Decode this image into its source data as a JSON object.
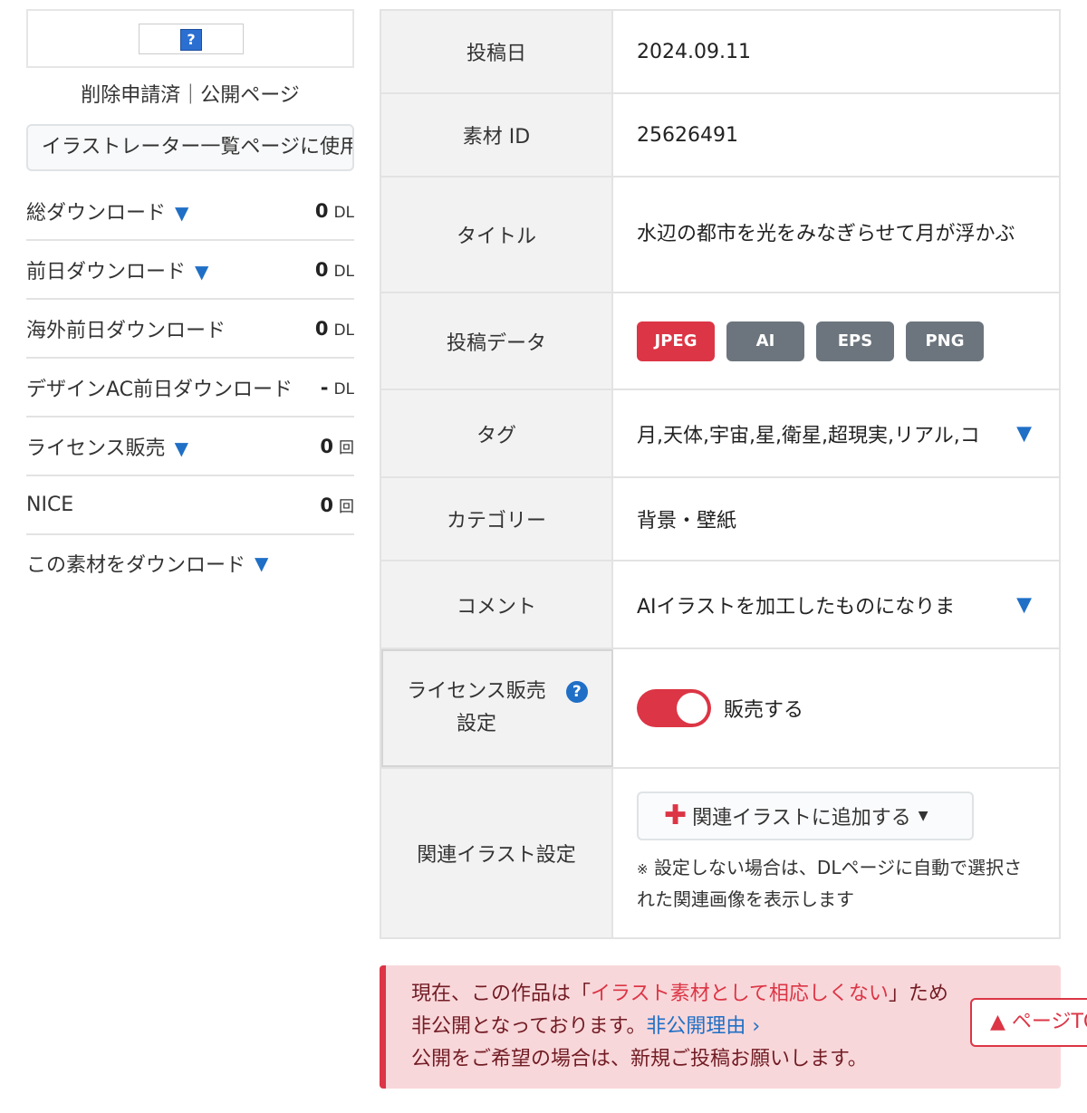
{
  "sidebar": {
    "thumbnail_icon": "question-icon",
    "thumbnail_glyph": "?",
    "status": "削除申請済｜公開ページ",
    "illustrator_button": "イラストレーター一覧ページに使用",
    "stats": [
      {
        "label": "総ダウンロード",
        "expand": "▼",
        "value": "0",
        "unit": "DL"
      },
      {
        "label": "前日ダウンロード",
        "expand": "▼",
        "value": "0",
        "unit": "DL"
      },
      {
        "label": "海外前日ダウンロード",
        "expand": "",
        "value": "0",
        "unit": "DL"
      },
      {
        "label": "デザインAC前日ダウンロード",
        "expand": "",
        "value": "-",
        "unit": "DL"
      },
      {
        "label": "ライセンス販売",
        "expand": "▼",
        "value": "0",
        "unit": "回"
      },
      {
        "label": "NICE",
        "expand": "",
        "value": "0",
        "unit": "回"
      }
    ],
    "download_link": "この素材をダウンロード",
    "download_expand": "▼"
  },
  "details": {
    "post_date_label": "投稿日",
    "post_date": "2024.09.11",
    "material_id_label": "素材 ID",
    "material_id": "25626491",
    "title_label": "タイトル",
    "title": "水辺の都市を光をみなぎらせて月が浮かぶ",
    "data_label": "投稿データ",
    "formats": [
      "JPEG",
      "AI",
      "EPS",
      "PNG"
    ],
    "tags_label": "タグ",
    "tags": "月,天体,宇宙,星,衛星,超現実,リアル,コ",
    "category_label": "カテゴリー",
    "category": "背景・壁紙",
    "comment_label": "コメント",
    "comment": "AIイラストを加工したものになりま",
    "license_label_1": "ライセンス販売",
    "license_label_2": "設定",
    "license_toggle_label": "販売する",
    "related_label": "関連イラスト設定",
    "related_button": "関連イラストに追加する",
    "related_note_mark": "※",
    "related_note": "設定しない場合は、DLページに自動で選択された関連画像を表示します"
  },
  "alert": {
    "line1_prefix": "現在、この作品は「",
    "line1_highlight": "イラスト素材として相応しくない",
    "line1_suffix": "」ため",
    "line2_prefix": "非公開となっております。",
    "line2_link": "非公開理由",
    "line2_chevron": "›",
    "line3": "公開をご希望の場合は、新規ご投稿お願いします。"
  },
  "page_top": "▲ ページTOP",
  "colors": {
    "accent_red": "#dc3545",
    "link_blue": "#1f6fc6",
    "badge_gray": "#6c757d"
  }
}
